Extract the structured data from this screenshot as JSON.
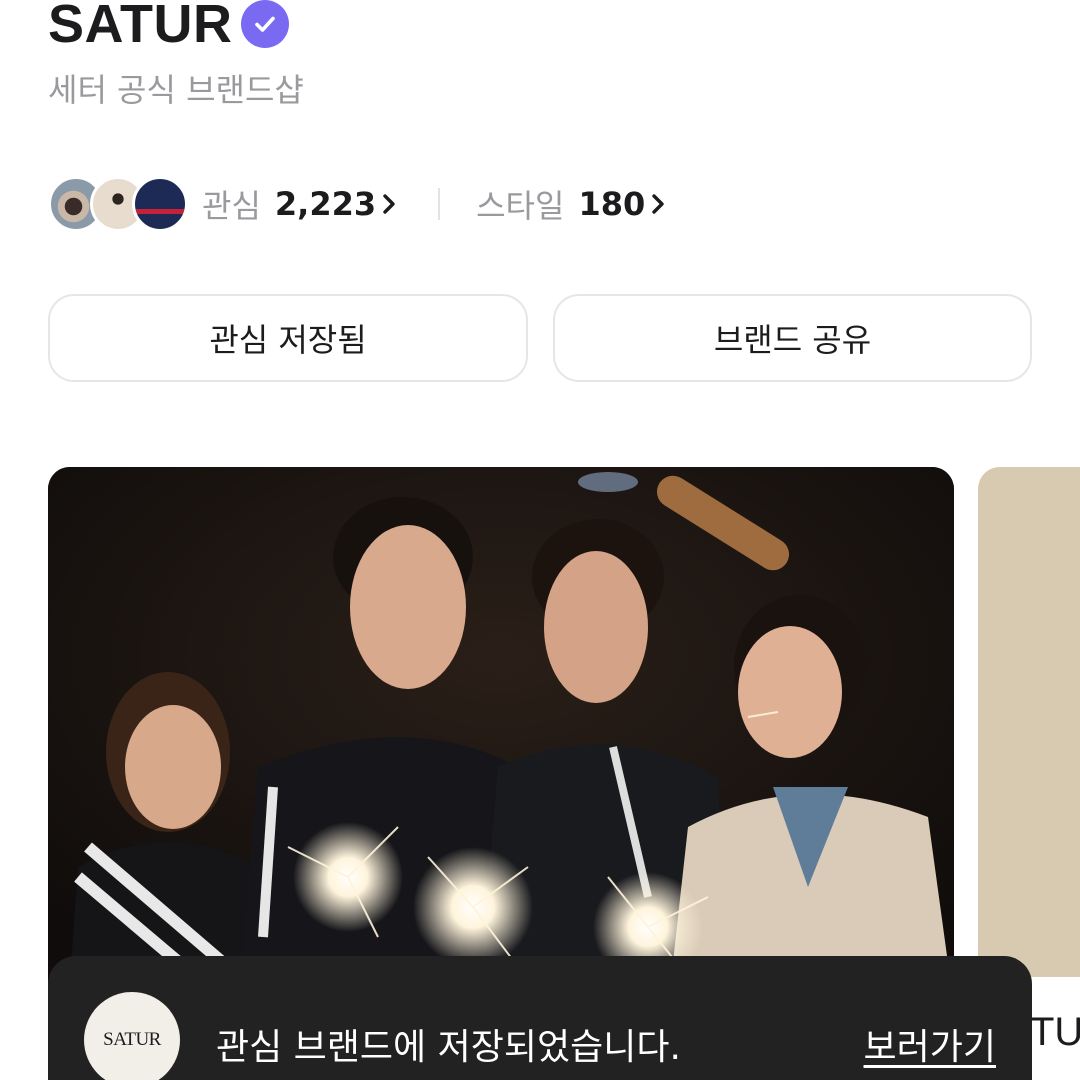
{
  "brand": {
    "name": "SATUR",
    "subtitle": "세터 공식 브랜드샵"
  },
  "stats": {
    "interest_label": "관심",
    "interest_value": "2,223",
    "style_label": "스타일",
    "style_value": "180"
  },
  "actions": {
    "save_label": "관심 저장됨",
    "share_label": "브랜드 공유"
  },
  "carousel": {
    "next_card_title": "TU"
  },
  "toast": {
    "logo_text": "SATUR",
    "message": "관심 브랜드에 저장되었습니다.",
    "link_label": "보러가기"
  },
  "colors": {
    "accent": "#7a6af2",
    "toast_bg": "#222222",
    "muted_text": "#9a9a9e"
  },
  "icons": [
    "verified-badge-icon",
    "chevron-right-icon"
  ]
}
